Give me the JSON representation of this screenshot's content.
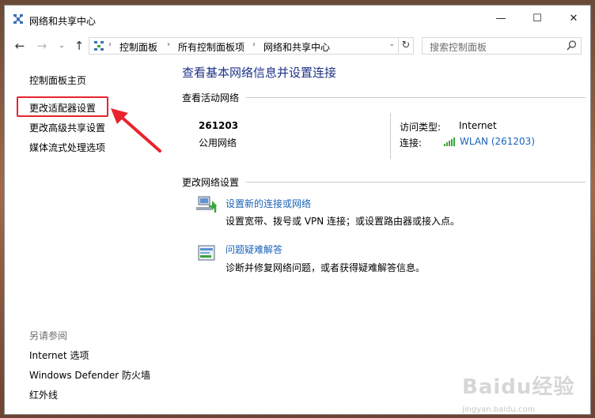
{
  "window": {
    "title": "网络和共享中心",
    "controls": {
      "minimize": "—",
      "maximize": "☐",
      "close": "✕"
    }
  },
  "nav": {
    "back": "←",
    "forward": "→",
    "recent": "⌄",
    "up": "↑"
  },
  "address": {
    "crumbs": [
      "控制面板",
      "所有控制面板项",
      "网络和共享中心"
    ],
    "separator": "›",
    "dropdown": "⌄",
    "refresh": "↻"
  },
  "search": {
    "placeholder": "搜索控制面板",
    "icon": "search-icon"
  },
  "sidebar": {
    "items": [
      {
        "label": "控制面板主页"
      },
      {
        "label": "更改适配器设置"
      },
      {
        "label": "更改高级共享设置"
      },
      {
        "label": "媒体流式处理选项"
      }
    ],
    "see_also_title": "另请参阅",
    "see_also": [
      {
        "label": "Internet 选项"
      },
      {
        "label": "Windows Defender 防火墙"
      },
      {
        "label": "红外线"
      }
    ]
  },
  "main": {
    "title": "查看基本网络信息并设置连接",
    "active_header": "查看活动网络",
    "network": {
      "name": "261203",
      "type": "公用网络",
      "access_label": "访问类型:",
      "access_value": "Internet",
      "conn_label": "连接:",
      "conn_value": "WLAN (261203)"
    },
    "change_header": "更改网络设置",
    "tasks": [
      {
        "title": "设置新的连接或网络",
        "desc": "设置宽带、拨号或 VPN 连接；或设置路由器或接入点。"
      },
      {
        "title": "问题疑难解答",
        "desc": "诊断并修复网络问题，或者获得疑难解答信息。"
      }
    ]
  },
  "watermark": {
    "text": "Baidu经验",
    "sub": "jingyan.baidu.com"
  },
  "colors": {
    "link": "#1a63b8",
    "title": "#1e3287",
    "highlight": "#e8242d",
    "wifi": "#3aa63a"
  }
}
